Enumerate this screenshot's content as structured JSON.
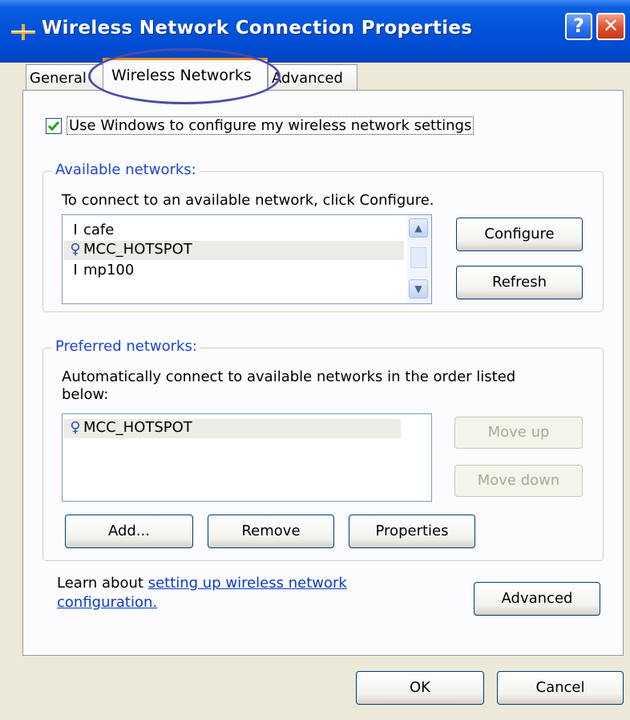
{
  "window": {
    "title": "Wireless Network Connection Properties",
    "help_label": "?",
    "close_label": "✕"
  },
  "tabs": [
    {
      "label": "General",
      "selected": false
    },
    {
      "label": "Wireless Networks",
      "selected": true
    },
    {
      "label": "Advanced",
      "selected": false
    }
  ],
  "use_windows": {
    "label": "Use Windows to configure my wireless network settings",
    "checked": true
  },
  "available": {
    "legend": "Available networks:",
    "instruction": "To connect to an available network, click Configure.",
    "networks": [
      {
        "name": "cafe",
        "icon": "antenna-icon"
      },
      {
        "name": "MCC_HOTSPOT",
        "icon": "connected-network-icon",
        "selected": true
      },
      {
        "name": "mp100",
        "icon": "antenna-icon"
      }
    ],
    "configure_label": "Configure",
    "refresh_label": "Refresh"
  },
  "preferred": {
    "legend": "Preferred networks:",
    "instruction": "Automatically connect to available networks in the order listed below:",
    "networks": [
      {
        "name": "MCC_HOTSPOT",
        "icon": "connected-network-icon"
      }
    ],
    "move_up_label": "Move up",
    "move_down_label": "Move down",
    "add_label": "Add...",
    "remove_label": "Remove",
    "properties_label": "Properties"
  },
  "learn": {
    "prefix": "Learn about ",
    "link_line1": "setting up wireless network",
    "link_line2": "configuration."
  },
  "advanced_label": "Advanced",
  "footer": {
    "ok_label": "OK",
    "cancel_label": "Cancel"
  },
  "colors": {
    "titlebar": "#0053d9",
    "legend": "#1f45d0",
    "link": "#0b3bc4",
    "highlight_oval": "#4c4ca8"
  }
}
